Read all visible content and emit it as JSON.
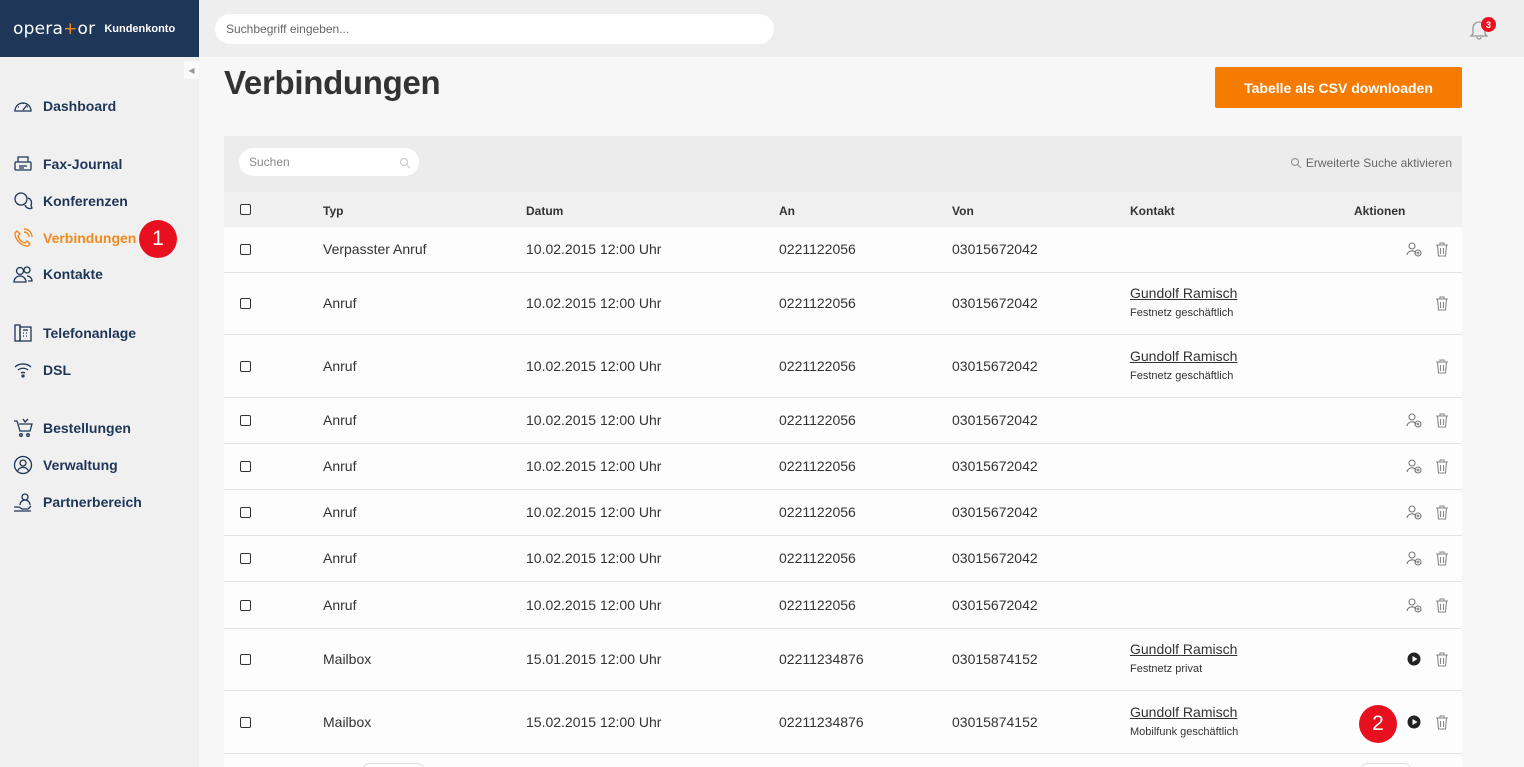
{
  "brand": {
    "logo_pre": "opera",
    "logo_plus": "+",
    "logo_post": "or",
    "sub": "Kundenkonto"
  },
  "sidebar": {
    "items": [
      {
        "label": "Dashboard",
        "icon": "speedometer-icon"
      },
      {
        "label": "Fax-Journal",
        "icon": "fax-icon"
      },
      {
        "label": "Konferenzen",
        "icon": "chat-bubbles-icon"
      },
      {
        "label": "Verbindungen",
        "icon": "phone-icon",
        "active": true
      },
      {
        "label": "Kontakte",
        "icon": "contacts-icon"
      },
      {
        "label": "Telefonanlage",
        "icon": "phone-system-icon"
      },
      {
        "label": "DSL",
        "icon": "wifi-icon"
      },
      {
        "label": "Bestellungen",
        "icon": "cart-icon"
      },
      {
        "label": "Verwaltung",
        "icon": "user-circle-icon"
      },
      {
        "label": "Partnerbereich",
        "icon": "partner-icon"
      }
    ]
  },
  "markers": {
    "one": "1",
    "two": "2"
  },
  "topbar": {
    "search_placeholder": "Suchbegriff eingeben...",
    "notification_count": "3"
  },
  "page": {
    "title": "Verbindungen",
    "csv_button": "Tabelle als CSV downloaden"
  },
  "table": {
    "search_placeholder": "Suchen",
    "advanced_search": "Erweiterte Suche aktivieren",
    "headers": {
      "typ": "Typ",
      "datum": "Datum",
      "an": "An",
      "von": "Von",
      "kontakt": "Kontakt",
      "aktionen": "Aktionen"
    },
    "rows": [
      {
        "typ": "Verpasster Anruf",
        "datum": "10.02.2015 12:00 Uhr",
        "an": "0221122056",
        "von": "03015672042",
        "kontakt": "",
        "kontakt_sub": "",
        "actions": [
          "add-contact",
          "delete"
        ]
      },
      {
        "typ": "Anruf",
        "datum": "10.02.2015 12:00 Uhr",
        "an": "0221122056",
        "von": "03015672042",
        "kontakt": "Gundolf Ramisch",
        "kontakt_sub": "Festnetz geschäftlich",
        "actions": [
          "delete"
        ]
      },
      {
        "typ": "Anruf",
        "datum": "10.02.2015 12:00 Uhr",
        "an": "0221122056",
        "von": "03015672042",
        "kontakt": "Gundolf Ramisch",
        "kontakt_sub": "Festnetz geschäftlich",
        "actions": [
          "delete"
        ]
      },
      {
        "typ": "Anruf",
        "datum": "10.02.2015 12:00 Uhr",
        "an": "0221122056",
        "von": "03015672042",
        "kontakt": "",
        "kontakt_sub": "",
        "actions": [
          "add-contact",
          "delete"
        ]
      },
      {
        "typ": "Anruf",
        "datum": "10.02.2015 12:00 Uhr",
        "an": "0221122056",
        "von": "03015672042",
        "kontakt": "",
        "kontakt_sub": "",
        "actions": [
          "add-contact",
          "delete"
        ]
      },
      {
        "typ": "Anruf",
        "datum": "10.02.2015 12:00 Uhr",
        "an": "0221122056",
        "von": "03015672042",
        "kontakt": "",
        "kontakt_sub": "",
        "actions": [
          "add-contact",
          "delete"
        ]
      },
      {
        "typ": "Anruf",
        "datum": "10.02.2015 12:00 Uhr",
        "an": "0221122056",
        "von": "03015672042",
        "kontakt": "",
        "kontakt_sub": "",
        "actions": [
          "add-contact",
          "delete"
        ]
      },
      {
        "typ": "Anruf",
        "datum": "10.02.2015 12:00 Uhr",
        "an": "0221122056",
        "von": "03015672042",
        "kontakt": "",
        "kontakt_sub": "",
        "actions": [
          "add-contact",
          "delete"
        ]
      },
      {
        "typ": "Mailbox",
        "datum": "15.01.2015 12:00 Uhr",
        "an": "02211234876",
        "von": "03015874152",
        "kontakt": "Gundolf Ramisch",
        "kontakt_sub": "Festnetz privat",
        "actions": [
          "play",
          "delete"
        ]
      },
      {
        "typ": "Mailbox",
        "datum": "15.02.2015 12:00 Uhr",
        "an": "02211234876",
        "von": "03015874152",
        "kontakt": "Gundolf Ramisch",
        "kontakt_sub": "Mobilfunk geschäftlich",
        "actions": [
          "play",
          "delete"
        ]
      }
    ]
  },
  "colors": {
    "brand_navy": "#1e3657",
    "accent_orange": "#f57c00",
    "marker_red": "#e8101f"
  }
}
